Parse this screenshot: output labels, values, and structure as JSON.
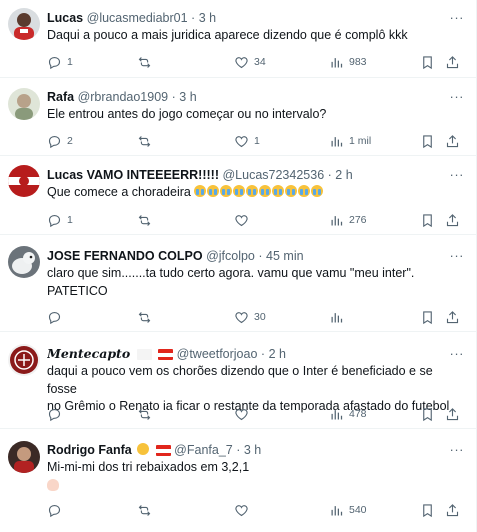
{
  "tweets": [
    {
      "name": "Lucas",
      "handle": "@lucasmediabr01",
      "time": "3 h",
      "text": "Daqui a pouco a mais juridica aparece dizendo que é complô kkk",
      "replies": "1",
      "retweets": "",
      "likes": "34",
      "views": "983",
      "avatar_color": "#c92a2a"
    },
    {
      "name": "Rafa",
      "handle": "@rbrandao1909",
      "time": "3 h",
      "text": "Ele entrou antes do jogo começar ou no intervalo?",
      "replies": "2",
      "retweets": "",
      "likes": "1",
      "views": "1 mil",
      "avatar_color": "#cfd8c8"
    },
    {
      "name": "Lucas VAMO INTEEEERR!!!!!",
      "handle": "@Lucas72342536",
      "time": "2 h",
      "text": "Que comece a choradeira",
      "emoji_count": 10,
      "emoji_name": "loudly-crying-face-emoji",
      "replies": "1",
      "retweets": "",
      "likes": "",
      "views": "276",
      "avatar_color": "#b71c1c"
    },
    {
      "name": "JOSE FERNANDO COLPO",
      "handle": "@jfcolpo",
      "time": "45 min",
      "text_lines": [
        "claro que sim.......ta tudo certo agora.  vamu que vamu \"meu inter\".",
        "PATETICO"
      ],
      "replies": "",
      "retweets": "",
      "likes": "30",
      "views": "",
      "avatar_color": "#4a4f55"
    },
    {
      "name": "Mentecapto",
      "handle": "@tweetforjoao",
      "time": "2 h",
      "text_lines": [
        "daqui a pouco vem os chorões dizendo que o Inter é beneficiado e se fosse",
        "no Grêmio o Renato ia ficar o restante da temporada afastado do futebol"
      ],
      "replies": "",
      "retweets": "",
      "likes": "",
      "views": "478",
      "avatar_color": "#8b1a1a"
    },
    {
      "name": "Rodrigo Fanfa",
      "handle": "@Fanfa_7",
      "time": "3 h",
      "text": "Mi-mi-mi dos tri rebaixados em 3,2,1",
      "replies": "",
      "retweets": "",
      "likes": "",
      "views": "540",
      "avatar_color": "#b22222"
    }
  ],
  "dot": "·",
  "more_label": "···",
  "colors": {
    "text_primary": "#0f1419",
    "text_secondary": "#536471",
    "divider": "#eff3f4",
    "flag_red": "#e1261c",
    "flag_white": "#ffffff"
  }
}
